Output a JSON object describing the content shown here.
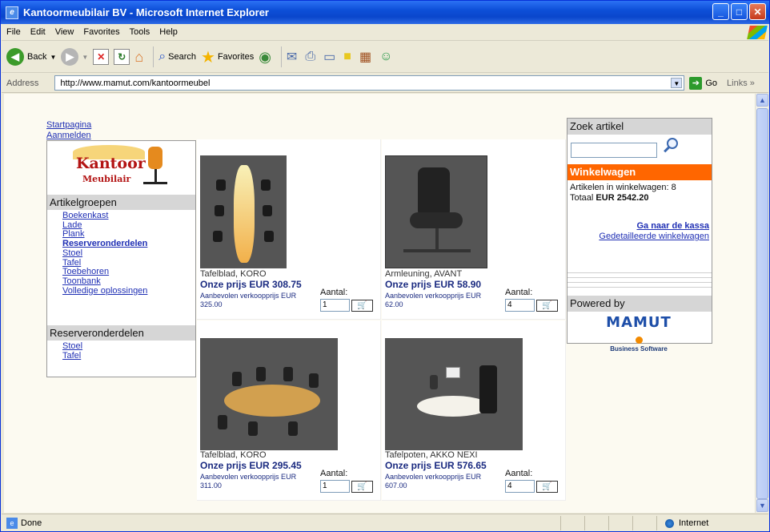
{
  "window": {
    "title": "Kantoormeubilair BV - Microsoft Internet Explorer"
  },
  "menu": [
    "File",
    "Edit",
    "View",
    "Favorites",
    "Tools",
    "Help"
  ],
  "toolbar": {
    "back": "Back",
    "search": "Search",
    "favorites": "Favorites"
  },
  "address": {
    "label": "Address",
    "url": "http://www.mamut.com/kantoormeubel",
    "go": "Go",
    "links": "Links"
  },
  "status": {
    "text": "Done",
    "zone": "Internet"
  },
  "page": {
    "top_links": [
      "Startpagina",
      "Aanmelden"
    ],
    "logo": {
      "line1": "Kantoor",
      "line2": "Meubilair"
    },
    "groups_heading": "Artikelgroepen",
    "groups": [
      {
        "label": "Boekenkast",
        "bold": false
      },
      {
        "label": "Lade",
        "bold": false
      },
      {
        "label": "Plank",
        "bold": false
      },
      {
        "label": "Reserveronderdelen",
        "bold": true
      },
      {
        "label": "Stoel",
        "bold": false
      },
      {
        "label": "Tafel",
        "bold": false
      },
      {
        "label": "Toebehoren",
        "bold": false
      },
      {
        "label": "Toonbank",
        "bold": false
      },
      {
        "label": "Volledige oplossingen",
        "bold": false
      }
    ],
    "sub_heading": "Reserveronderdelen",
    "sub_items": [
      "Stoel",
      "Tafel"
    ],
    "products": [
      {
        "name": "Tafelblad, KORO",
        "price": "Onze prijs EUR 308.75",
        "rec": "Aanbevolen verkoopprijs EUR 325.00",
        "qty_label": "Aantal:",
        "qty": "1"
      },
      {
        "name": "Armleuning, AVANT",
        "price": "Onze prijs EUR 58.90",
        "rec": "Aanbevolen verkoopprijs EUR 62.00",
        "qty_label": "Aantal:",
        "qty": "4"
      },
      {
        "name": "Tafelblad, KORO",
        "price": "Onze prijs EUR 295.45",
        "rec": "Aanbevolen verkoopprijs EUR 311.00",
        "qty_label": "Aantal:",
        "qty": "1"
      },
      {
        "name": "Tafelpoten, AKKO NEXI",
        "price": "Onze prijs EUR 576.65",
        "rec": "Aanbevolen verkoopprijs EUR 607.00",
        "qty_label": "Aantal:",
        "qty": "4"
      }
    ],
    "search_heading": "Zoek artikel",
    "cart_heading": "Winkelwagen",
    "cart_items": "Artikelen in winkelwagen: 8",
    "cart_total_label": "Totaal",
    "cart_total": "EUR 2542.20",
    "checkout_link": "Ga naar de kassa",
    "detail_link": "Gedetailleerde winkelwagen",
    "powered_by": "Powered by",
    "mamut": {
      "name": "MAMUT",
      "tagline": "Business Software"
    }
  },
  "colors": {
    "accent": "#ff6600",
    "link": "#1f2fb4",
    "price": "#1a2a80"
  }
}
